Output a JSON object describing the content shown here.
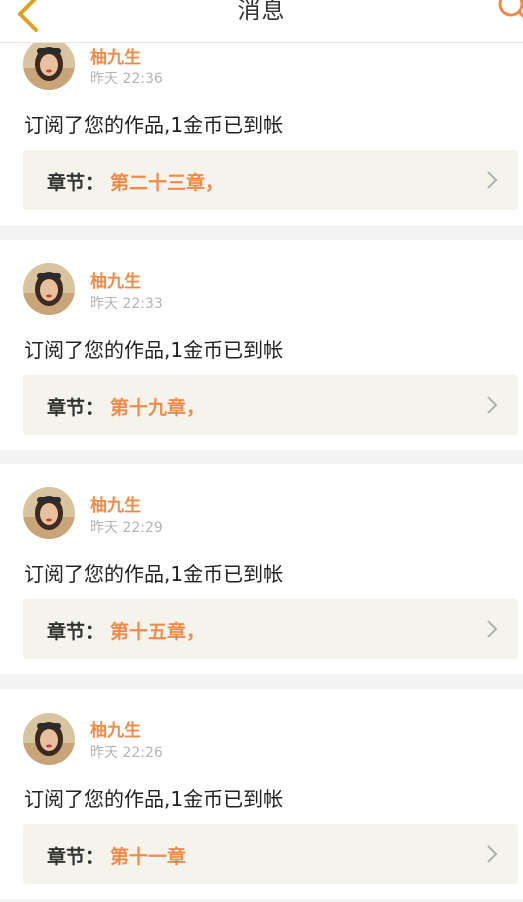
{
  "header": {
    "title": "消息"
  },
  "notifications": [
    {
      "sender": "柚九生",
      "time": "昨天 22:36",
      "message": "订阅了您的作品,1金币已到帐",
      "chapter_label": "章节：",
      "chapter_value": "第二十三章，"
    },
    {
      "sender": "柚九生",
      "time": "昨天 22:33",
      "message": "订阅了您的作品,1金币已到帐",
      "chapter_label": "章节：",
      "chapter_value": "第十九章，"
    },
    {
      "sender": "柚九生",
      "time": "昨天 22:29",
      "message": "订阅了您的作品,1金币已到帐",
      "chapter_label": "章节：",
      "chapter_value": "第十五章，"
    },
    {
      "sender": "柚九生",
      "time": "昨天 22:26",
      "message": "订阅了您的作品,1金币已到帐",
      "chapter_label": "章节：",
      "chapter_value": "第十一章"
    }
  ],
  "colors": {
    "accent": "#ef8c4c",
    "back_arrow": "#e0a020",
    "chapter_bg": "#f5f4ec"
  },
  "icons": {
    "back": "back-arrow-icon",
    "search": "search-icon",
    "chevron": "chevron-right-icon"
  }
}
